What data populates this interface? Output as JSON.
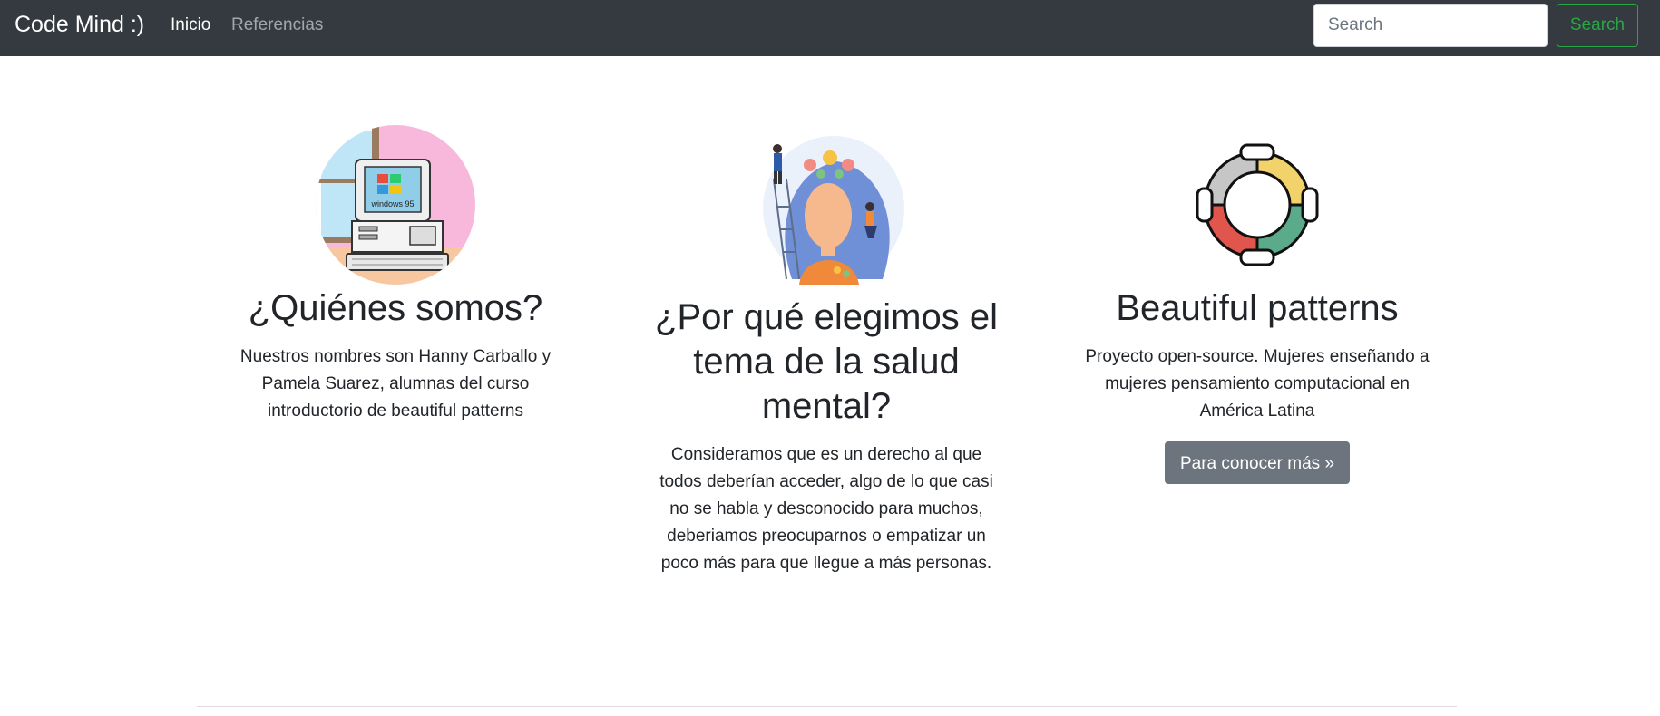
{
  "navbar": {
    "brand": "Code Mind :)",
    "links": [
      {
        "label": "Inicio",
        "active": true
      },
      {
        "label": "Referencias",
        "active": false
      }
    ],
    "search": {
      "placeholder": "Search",
      "value": "",
      "button_label": "Search"
    }
  },
  "columns": [
    {
      "title": "¿Quiénes somos?",
      "text": "Nuestros nombres son Hanny Carballo y Pamela Suarez, alumnas del curso introductorio de beautiful patterns",
      "image": "retro-computer-illustration",
      "screen_label": "windows 95"
    },
    {
      "title": "¿Por qué elegimos el tema de la salud mental?",
      "text": "Consideramos que es un derecho al que todos deberían acceder, algo de lo que casi no se habla y desconocido para muchos, deberiamos preocuparnos o empatizar un poco más para que llegue a más personas.",
      "image": "mental-health-flowers-head-illustration"
    },
    {
      "title": "Beautiful patterns",
      "text": "Proyecto open-source. Mujeres enseñando a mujeres pensamiento computacional en América Latina",
      "image": "hands-circle-logo",
      "button_label": "Para conocer más »"
    }
  ],
  "colors": {
    "navbar_bg": "#343a40",
    "success": "#28a745",
    "secondary": "#6c757d",
    "hand_colors": [
      "#f2d36b",
      "#5bab8a",
      "#e0564d",
      "#c6c6c6"
    ]
  }
}
